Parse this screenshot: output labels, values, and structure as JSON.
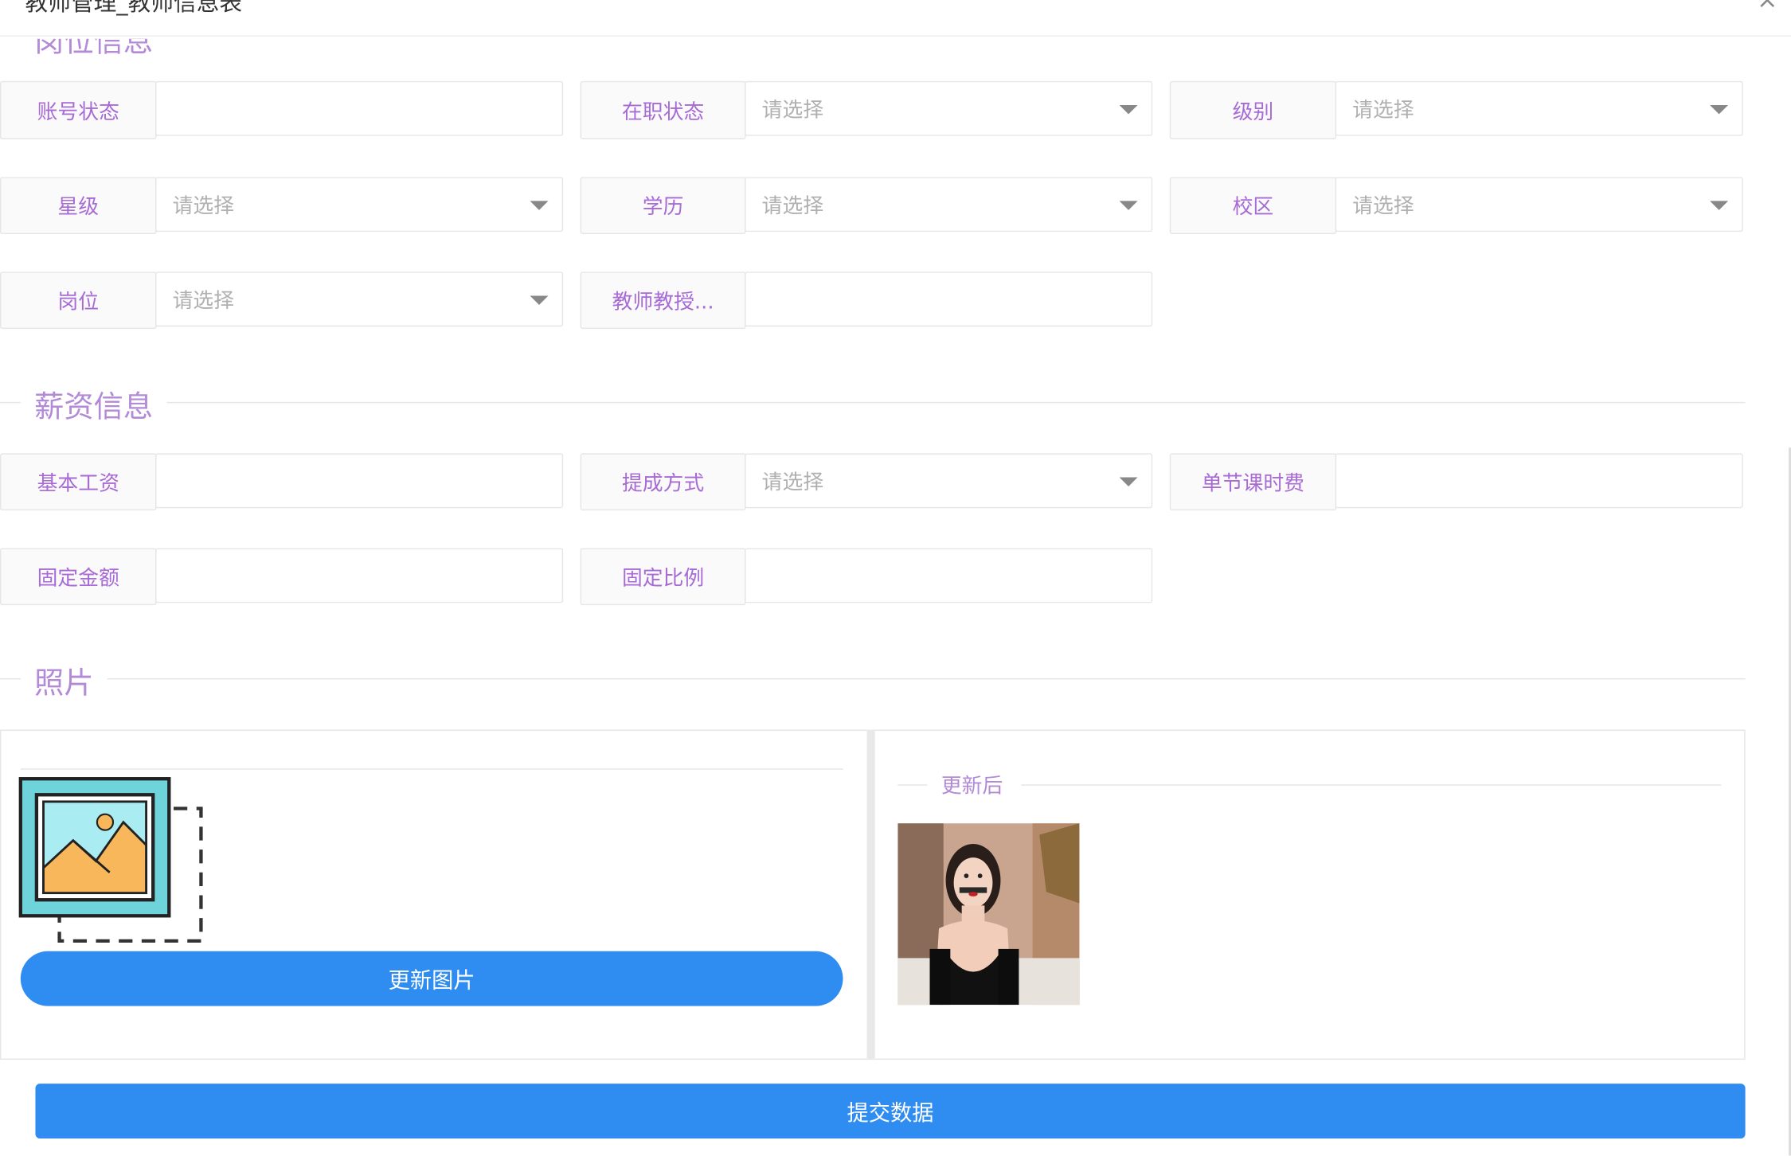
{
  "dialog": {
    "title": "教师管理_教师信息表",
    "close_label": "×"
  },
  "sections": {
    "position": "岗位信息",
    "salary": "薪资信息",
    "photo": "照片"
  },
  "position_fields": {
    "account_status": {
      "label": "账号状态",
      "value": ""
    },
    "job_status": {
      "label": "在职状态",
      "placeholder": "请选择"
    },
    "level": {
      "label": "级别",
      "placeholder": "请选择"
    },
    "star_level": {
      "label": "星级",
      "placeholder": "请选择"
    },
    "education": {
      "label": "学历",
      "placeholder": "请选择"
    },
    "campus": {
      "label": "校区",
      "placeholder": "请选择"
    },
    "post": {
      "label": "岗位",
      "placeholder": "请选择"
    },
    "teacher_subject": {
      "label": "教师教授...",
      "value": ""
    }
  },
  "salary_fields": {
    "base_salary": {
      "label": "基本工资",
      "value": ""
    },
    "commission_method": {
      "label": "提成方式",
      "placeholder": "请选择"
    },
    "lesson_fee": {
      "label": "单节课时费",
      "value": ""
    },
    "fixed_amount": {
      "label": "固定金额",
      "value": ""
    },
    "fixed_ratio": {
      "label": "固定比例",
      "value": ""
    }
  },
  "photo": {
    "updated_label": "更新后",
    "update_button": "更新图片",
    "placeholder_icon": "image-placeholder-icon"
  },
  "submit_button": "提交数据",
  "colors": {
    "accent_purple": "#a86bd6",
    "primary_blue": "#2f8cf0"
  }
}
